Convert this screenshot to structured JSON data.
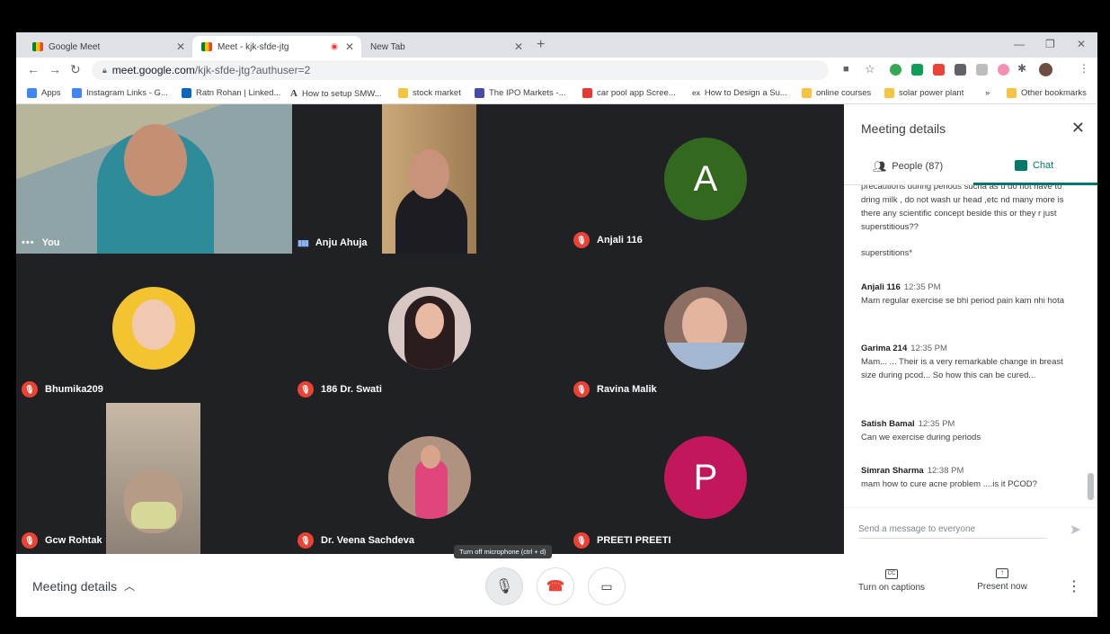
{
  "browser": {
    "tabs": [
      {
        "label": "Google Meet"
      },
      {
        "label": "Meet - kjk-sfde-jtg"
      },
      {
        "label": "New Tab"
      }
    ],
    "url_host": "meet.google.com",
    "url_path": "/kjk-sfde-jtg?authuser=2",
    "bookmarks": [
      {
        "label": "Apps",
        "icon": "apps-grid-icon",
        "color": "#4285f4"
      },
      {
        "label": "Instagram Links - G...",
        "icon": "docs-icon",
        "color": "#4285f4"
      },
      {
        "label": "Ratn Rohan | Linked...",
        "icon": "linkedin-icon",
        "color": "#0a66c2"
      },
      {
        "label": "How to setup SMW...",
        "icon": "a-icon",
        "color": "#000000"
      },
      {
        "label": "stock market",
        "icon": "folder-icon",
        "color": "#f6c342"
      },
      {
        "label": "The IPO Markets -...",
        "icon": "ipo-icon",
        "color": "#4a4aa8"
      },
      {
        "label": "car pool app Scree...",
        "icon": "carpool-icon",
        "color": "#e53935"
      },
      {
        "label": "How to Design a Su...",
        "icon": "design-icon",
        "color": "#5f6368"
      },
      {
        "label": "online courses",
        "icon": "folder-icon",
        "color": "#f6c342"
      },
      {
        "label": "solar power plant",
        "icon": "folder-icon",
        "color": "#f6c342"
      },
      {
        "label": "»",
        "icon": "more-icon",
        "color": "#5f6368"
      },
      {
        "label": "Other bookmarks",
        "icon": "folder-icon",
        "color": "#f6c342"
      }
    ]
  },
  "participants": [
    {
      "name": "You",
      "status": "menu",
      "kind": "video",
      "bg": "#7c8b8e"
    },
    {
      "name": "Anju Ahuja",
      "status": "speaking",
      "kind": "video",
      "bg": "#3a3b3f"
    },
    {
      "name": "Anjali 116",
      "status": "muted",
      "kind": "letter",
      "letter": "A",
      "bg": "#33691e"
    },
    {
      "name": "Bhumika209",
      "status": "muted",
      "kind": "avatar",
      "bg": "#f4c430"
    },
    {
      "name": "186 Dr. Swati",
      "status": "muted",
      "kind": "avatar",
      "bg": "#c6a6a6"
    },
    {
      "name": "Ravina Malik",
      "status": "muted",
      "kind": "avatar",
      "bg": "#8d6e63"
    },
    {
      "name": "Gcw Rohtak",
      "status": "muted",
      "kind": "video",
      "bg": "#a89a8c"
    },
    {
      "name": "Dr. Veena Sachdeva",
      "status": "muted",
      "kind": "avatar",
      "bg": "#b85d5d"
    },
    {
      "name": "PREETI PREETI",
      "status": "muted",
      "kind": "letter",
      "letter": "P",
      "bg": "#c2185b"
    }
  ],
  "panel": {
    "title": "Meeting details",
    "people_label": "People (87)",
    "chat_label": "Chat",
    "messages": [
      {
        "sender": "",
        "time": "",
        "text": "precautions during periods sucha as u do not have to dring milk , do not wash ur head ,etc nd many more is there any scientific concept beside this or they r just superstitious??"
      },
      {
        "sender": "",
        "time": "",
        "text": "superstitions*"
      },
      {
        "sender": "Anjali 116",
        "time": "12:35 PM",
        "text": "Mam regular exercise se bhi period pain kam nhi hota"
      },
      {
        "sender": "Garima 214",
        "time": "12:35 PM",
        "text": "Mam... ... Their is a very remarkable change in breast size  during pcod... So how this can be cured..."
      },
      {
        "sender": "Satish Bamal",
        "time": "12:35 PM",
        "text": "Can we exercise during periods"
      },
      {
        "sender": "Simran Sharma",
        "time": "12:38 PM",
        "text": "mam how to cure acne problem ....is it PCOD?"
      }
    ],
    "send_placeholder": "Send a message to everyone"
  },
  "bottom": {
    "meeting_details_label": "Meeting details",
    "tooltip": "Turn off microphone (ctrl + d)",
    "captions_label": "Turn on captions",
    "present_label": "Present now",
    "captions_icon_text": "CC"
  },
  "colors": {
    "muted_red": "#ea4335",
    "chat_accent": "#00796b",
    "tile_bg": "#202124"
  }
}
